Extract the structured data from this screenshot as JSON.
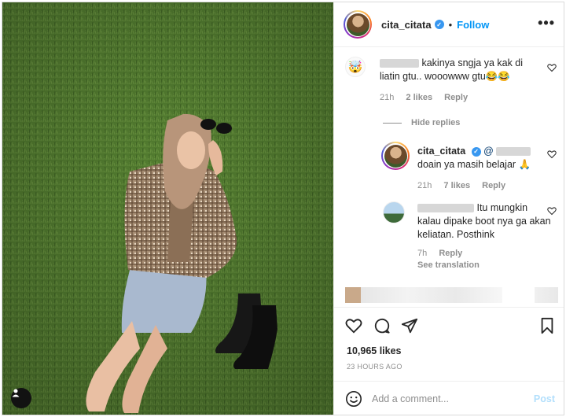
{
  "header": {
    "username": "cita_citata",
    "separator": "•",
    "follow_label": "Follow",
    "more_label": "•••"
  },
  "comments": [
    {
      "text": "kakinya sngja ya kak di liatin gtu.. wooowww gtu😂😂",
      "time": "21h",
      "likes": "2 likes",
      "reply": "Reply",
      "avatar_emoji": "🤯"
    }
  ],
  "hide_replies": "Hide replies",
  "replies": [
    {
      "username": "cita_citata",
      "mention": "@",
      "text": "doain ya masih belajar 🙏",
      "time": "21h",
      "likes": "7 likes",
      "reply": "Reply"
    },
    {
      "text": "Itu mungkin kalau dipake boot nya ga akan keliatan. Posthink",
      "time": "7h",
      "reply": "Reply",
      "translation": "See translation"
    }
  ],
  "post": {
    "likes": "10,965 likes",
    "time": "23 HOURS AGO",
    "comment_placeholder": "Add a comment...",
    "post_label": "Post"
  },
  "colors": {
    "link": "#0095f6",
    "grass": "#4f7a2e",
    "muted": "#8e8e8e"
  }
}
